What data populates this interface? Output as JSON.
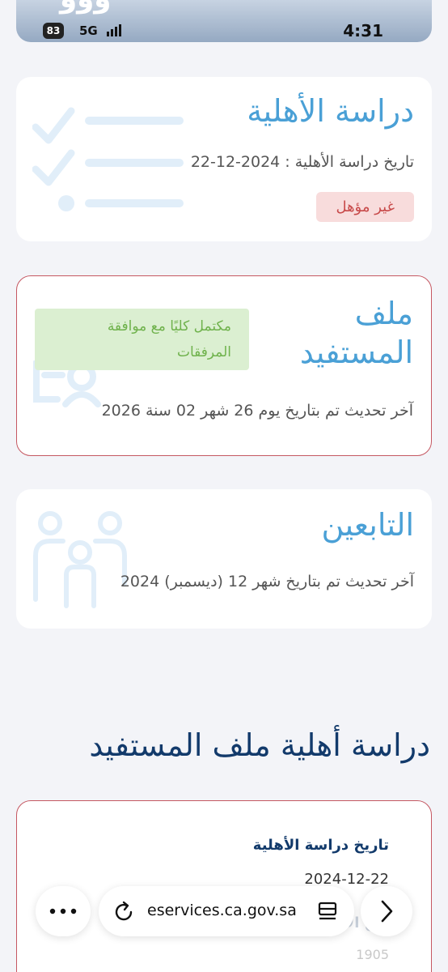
{
  "status_bar": {
    "battery": "83",
    "network": "5G",
    "time": "4:31",
    "top_partial_digits": "ووو"
  },
  "eligibility_card": {
    "title": "دراسة الأهلية",
    "date_text": "تاريخ دراسة الأهلية : 2024-12-22",
    "badge": "غير مؤهل",
    "icon": "checklist-icon"
  },
  "beneficiary_card": {
    "title_line1": "ملف",
    "title_line2": "المستفيد",
    "badge_line1": "مكتمل كليًا مع موافقة",
    "badge_line2": "المرفقات",
    "updated_text": "آخر تحديث تم بتاريخ يوم 26 شهر 02 سنة 2026",
    "icon": "user-profile-icon"
  },
  "dependents_card": {
    "title": "التابعين",
    "updated_text": "آخر تحديث تم بتاريخ شهر 12 (ديسمبر) 2024",
    "icon": "family-icon"
  },
  "eligibility_section": {
    "heading": "دراسة أهلية ملف المستفيد",
    "study_date_label": "تاريخ دراسة الأهلية",
    "study_date_value": "2024-12-22",
    "faded_label": "نوع الأهلية",
    "faded_number": "1905"
  },
  "browser": {
    "url": "eservices.ca.gov.sa",
    "more_icon": "more-dots-icon",
    "reload_icon": "reload-icon",
    "reader_icon": "reader-mode-icon",
    "forward_icon": "chevron-right-icon"
  },
  "colors": {
    "accent_blue": "#4aa0d6",
    "heading_navy": "#123a6b",
    "danger_border": "#c55862",
    "danger_bg": "#f8dcdc",
    "success_bg": "#dbefd1",
    "success_text": "#6fb24c"
  }
}
